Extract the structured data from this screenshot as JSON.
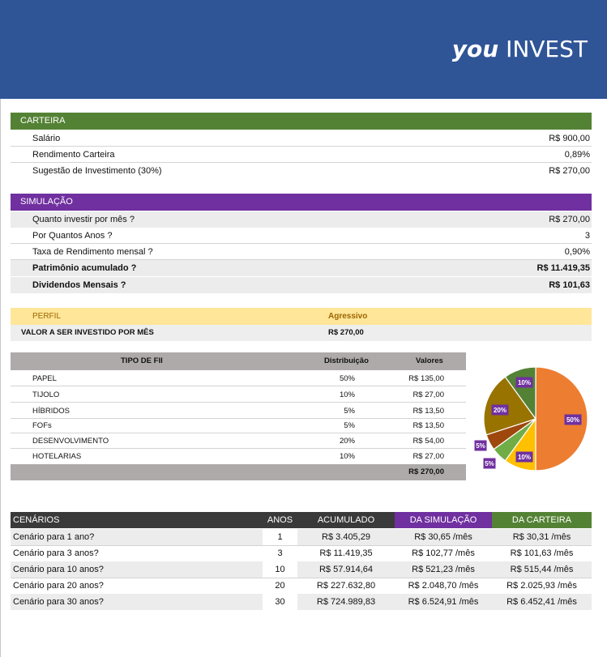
{
  "header": {
    "brand_you": "you",
    "brand_invest": "INVEST",
    "color": "#2f5597"
  },
  "carteira": {
    "title": "CARTEIRA",
    "rows": [
      {
        "label": "Salário",
        "value": "R$ 900,00"
      },
      {
        "label": "Rendimento Carteira",
        "value": "0,89%"
      },
      {
        "label": "Sugestão de Investimento (30%)",
        "value": "R$ 270,00"
      }
    ]
  },
  "simulacao": {
    "title": "SIMULAÇÃO",
    "rows": [
      {
        "label": "Quanto investir por mês ?",
        "value": "R$ 270,00"
      },
      {
        "label": "Por Quantos Anos ?",
        "value": "3"
      },
      {
        "label": "Taxa de Rendimento mensal ?",
        "value": "0,90%"
      },
      {
        "label": "Patrimônio acumulado ?",
        "value": "R$ 11.419,35"
      },
      {
        "label": "Dividendos Mensais ?",
        "value": "R$ 101,63"
      }
    ]
  },
  "perfil": {
    "label": "PERFIL",
    "value": "Agressivo",
    "valor_label": "VALOR A SER INVESTIDO POR MÊS",
    "valor_value": "R$ 270,00"
  },
  "fii": {
    "headers": {
      "tipo": "TIPO DE FII",
      "distribuicao": "Distribuição",
      "valores": "Valores"
    },
    "rows": [
      {
        "name": "PAPEL",
        "pct": "50%",
        "value": "R$ 135,00"
      },
      {
        "name": "TIJOLO",
        "pct": "10%",
        "value": "R$ 27,00"
      },
      {
        "name": "HÍBRIDOS",
        "pct": "5%",
        "value": "R$ 13,50"
      },
      {
        "name": "FOFs",
        "pct": "5%",
        "value": "R$ 13,50"
      },
      {
        "name": "DESENVOLVIMENTO",
        "pct": "20%",
        "value": "R$ 54,00"
      },
      {
        "name": "HOTELARIAS",
        "pct": "10%",
        "value": "R$ 27,00"
      }
    ],
    "total": "R$ 270,00"
  },
  "chart_data": {
    "type": "pie",
    "labels": [
      "50%",
      "10%",
      "5%",
      "5%",
      "20%",
      "10%"
    ],
    "values": [
      50,
      10,
      5,
      5,
      20,
      10
    ],
    "colors": [
      "#ed7d31",
      "#ffc000",
      "#70ad47",
      "#9e480e",
      "#997300",
      "#548235"
    ]
  },
  "cenarios": {
    "headers": {
      "cenarios": "CENÁRIOS",
      "anos": "ANOS",
      "acumulado": "ACUMULADO",
      "simulacao": "DA SIMULAÇÃO",
      "carteira": "DA CARTEIRA"
    },
    "rows": [
      {
        "name": "Cenário para 1 ano?",
        "anos": "1",
        "acumulado": "R$ 3.405,29",
        "simulacao": "R$ 30,65 /mês",
        "carteira": "R$ 30,31 /mês"
      },
      {
        "name": "Cenário para 3 anos?",
        "anos": "3",
        "acumulado": "R$ 11.419,35",
        "simulacao": "R$ 102,77 /mês",
        "carteira": "R$ 101,63 /mês"
      },
      {
        "name": "Cenário para 10 anos?",
        "anos": "10",
        "acumulado": "R$ 57.914,64",
        "simulacao": "R$ 521,23 /mês",
        "carteira": "R$ 515,44 /mês"
      },
      {
        "name": "Cenário para 20 anos?",
        "anos": "20",
        "acumulado": "R$ 227.632,80",
        "simulacao": "R$ 2.048,70 /mês",
        "carteira": "R$ 2.025,93 /mês"
      },
      {
        "name": "Cenário para 30 anos?",
        "anos": "30",
        "acumulado": "R$ 724.989,83",
        "simulacao": "R$ 6.524,91 /mês",
        "carteira": "R$ 6.452,41 /mês"
      }
    ]
  }
}
